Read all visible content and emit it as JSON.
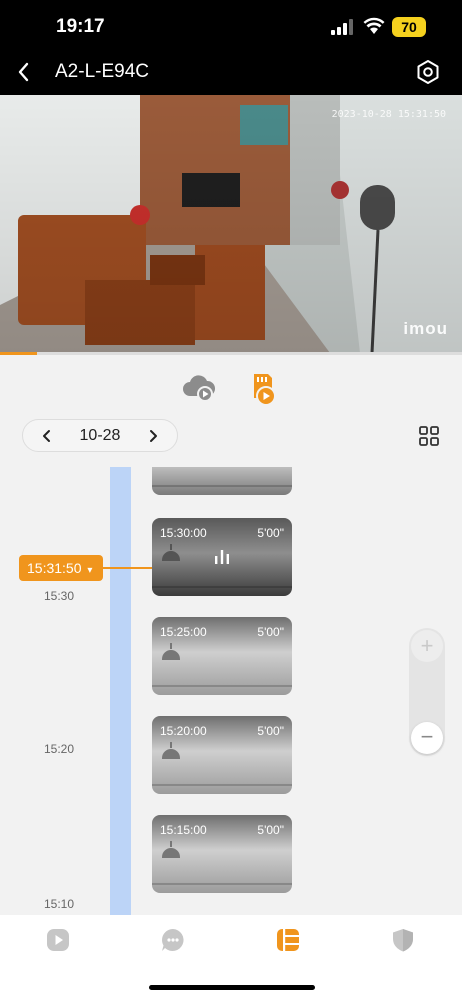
{
  "status_bar": {
    "time": "19:17",
    "battery": "70"
  },
  "header": {
    "title": "A2-L-E94C"
  },
  "video": {
    "timestamp": "2023-10-28 15:31:50",
    "logo": "imou",
    "progress": 0.08
  },
  "date_nav": {
    "date": "10-28"
  },
  "timeline": {
    "current_time": "15:31:50",
    "ticks": [
      "15:30",
      "15:20",
      "15:10"
    ]
  },
  "clips": [
    {
      "time": "15:30:00",
      "duration": "5'00\""
    },
    {
      "time": "15:25:00",
      "duration": "5'00\""
    },
    {
      "time": "15:20:00",
      "duration": "5'00\""
    },
    {
      "time": "15:15:00",
      "duration": "5'00\""
    }
  ],
  "colors": {
    "accent": "#f0951d",
    "timeline": "#bcd4f7"
  },
  "icons": {
    "back": "chevron-left-icon",
    "settings": "hexagon-gear-icon",
    "cloud": "cloud-play-icon",
    "sd_card": "sd-card-play-icon",
    "grid": "grid-icon",
    "tabs": [
      "play-icon",
      "chat-icon",
      "list-icon",
      "shield-icon"
    ]
  }
}
